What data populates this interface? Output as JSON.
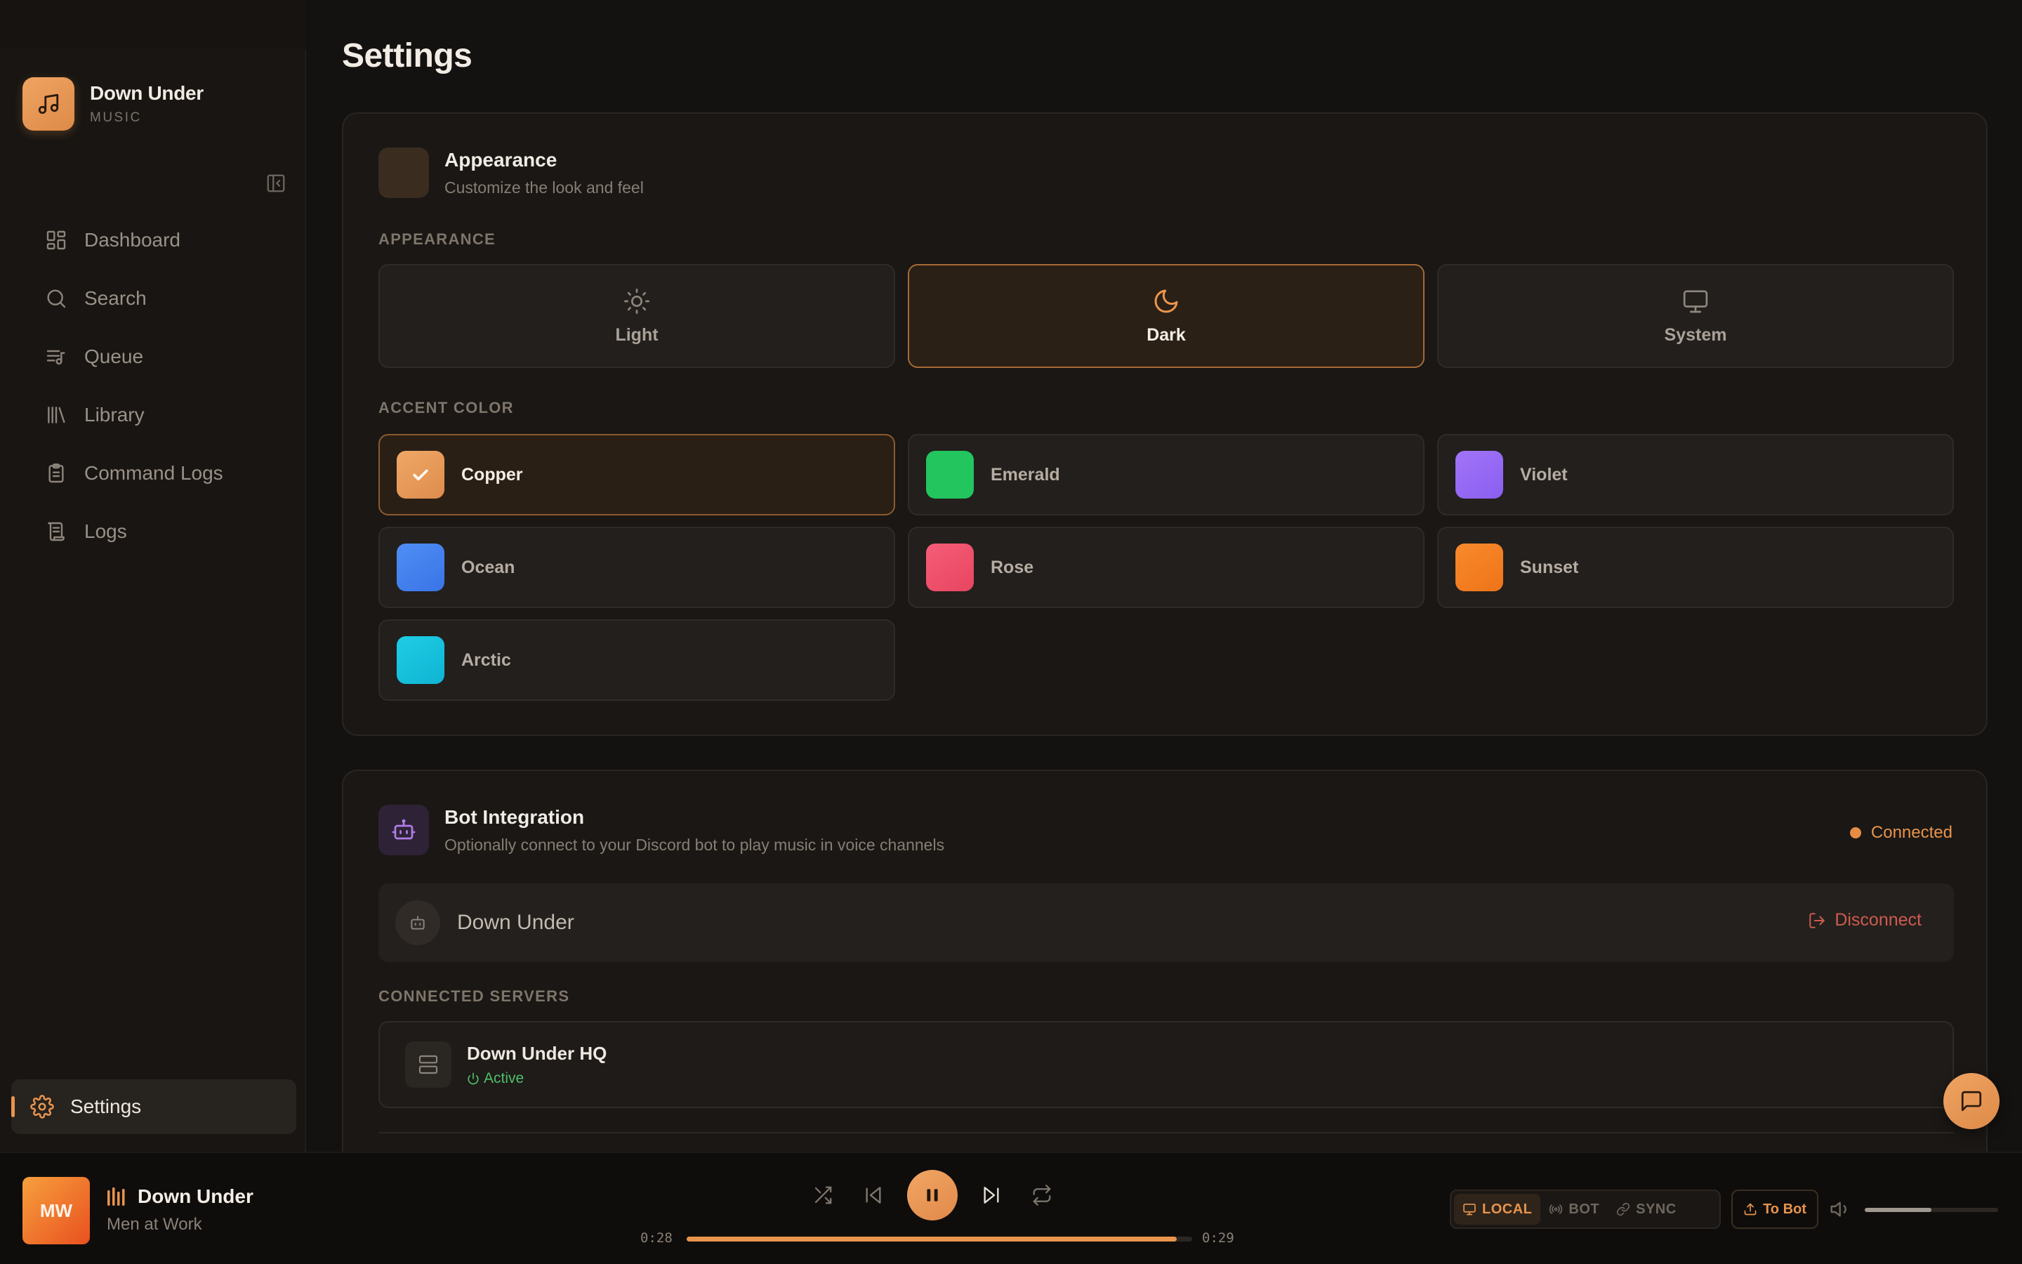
{
  "app": {
    "name": "Down Under",
    "subtitle": "MUSIC"
  },
  "sidebar": {
    "items": [
      {
        "label": "Dashboard",
        "icon": "dashboard-icon"
      },
      {
        "label": "Search",
        "icon": "search-icon"
      },
      {
        "label": "Queue",
        "icon": "queue-icon"
      },
      {
        "label": "Library",
        "icon": "library-icon"
      },
      {
        "label": "Command Logs",
        "icon": "clipboard-icon"
      },
      {
        "label": "Logs",
        "icon": "scroll-icon"
      }
    ],
    "settings": {
      "label": "Settings",
      "icon": "gear-icon",
      "active": true
    }
  },
  "page": {
    "title": "Settings"
  },
  "appearance": {
    "title": "Appearance",
    "description": "Customize the look and feel",
    "mode_label": "APPEARANCE",
    "modes": [
      {
        "label": "Light",
        "icon": "sun-icon",
        "selected": false
      },
      {
        "label": "Dark",
        "icon": "moon-icon",
        "selected": true
      },
      {
        "label": "System",
        "icon": "monitor-icon",
        "selected": false
      }
    ],
    "accent_label": "ACCENT COLOR",
    "accents": [
      {
        "name": "Copper",
        "color": "#e8a060",
        "selected": true
      },
      {
        "name": "Emerald",
        "color": "#22c55e",
        "selected": false
      },
      {
        "name": "Violet",
        "color": "#9b6cf6",
        "selected": false
      },
      {
        "name": "Ocean",
        "color": "#4a86f2",
        "selected": false
      },
      {
        "name": "Rose",
        "color": "#f0536f",
        "selected": false
      },
      {
        "name": "Sunset",
        "color": "#f58224",
        "selected": false
      },
      {
        "name": "Arctic",
        "color": "#16c2de",
        "selected": false
      }
    ]
  },
  "bot": {
    "title": "Bot Integration",
    "description": "Optionally connect to your Discord bot to play music in voice channels",
    "status": "Connected",
    "bot_name": "Down Under",
    "disconnect_label": "Disconnect",
    "servers_label": "CONNECTED SERVERS",
    "servers": [
      {
        "name": "Down Under HQ",
        "status": "Active"
      }
    ]
  },
  "player": {
    "album_initials": "MW",
    "track_title": "Down Under",
    "artist": "Men at Work",
    "current_time": "0:28",
    "total_time": "0:29",
    "progress": 0.97,
    "volume": 0.5,
    "modes": [
      {
        "label": "LOCAL",
        "icon": "monitor-icon",
        "active": true
      },
      {
        "label": "BOT",
        "icon": "broadcast-icon",
        "active": false
      },
      {
        "label": "SYNC",
        "icon": "link-icon",
        "active": false
      }
    ],
    "to_bot_label": "To Bot"
  },
  "colors": {
    "accent": "#e8944d",
    "background": "#141210",
    "danger": "#cc5c4f",
    "success": "#4fbf6a"
  }
}
